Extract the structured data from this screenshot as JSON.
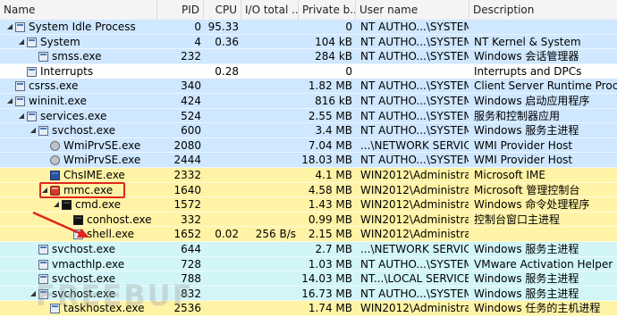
{
  "columns": {
    "name": "Name",
    "pid": "PID",
    "cpu": "CPU",
    "io": "I/O total ...",
    "private": "Private b...",
    "user": "User name",
    "description": "Description"
  },
  "colors": {
    "service": "#cfe7ff",
    "own": "#fff3a6",
    "system": "#ffffff",
    "network": "#d2f5f8",
    "highlight_box": "#e0261f",
    "arrow": "#e0261f"
  },
  "processes": [
    {
      "name": "System Idle Process",
      "pid": "0",
      "cpu": "95.33",
      "io": "",
      "private": "0",
      "user": "NT AUTHO...\\SYSTEM",
      "description": "",
      "indent": 0,
      "twisty": "open",
      "icon": "window-icon",
      "kind": "service"
    },
    {
      "name": "System",
      "pid": "4",
      "cpu": "0.36",
      "io": "",
      "private": "104 kB",
      "user": "NT AUTHO...\\SYSTEM",
      "description": "NT Kernel & System",
      "indent": 1,
      "twisty": "open",
      "icon": "window-icon",
      "kind": "service"
    },
    {
      "name": "smss.exe",
      "pid": "232",
      "cpu": "",
      "io": "",
      "private": "284 kB",
      "user": "NT AUTHO...\\SYSTEM",
      "description": "Windows 会话管理器",
      "indent": 2,
      "twisty": "",
      "icon": "window-icon",
      "kind": "service"
    },
    {
      "name": "Interrupts",
      "pid": "",
      "cpu": "0.28",
      "io": "",
      "private": "0",
      "user": "",
      "description": "Interrupts and DPCs",
      "indent": 1,
      "twisty": "",
      "icon": "window-icon",
      "kind": "system"
    },
    {
      "name": "csrss.exe",
      "pid": "340",
      "cpu": "",
      "io": "",
      "private": "1.82 MB",
      "user": "NT AUTHO...\\SYSTEM",
      "description": "Client Server Runtime Proc...",
      "indent": 0,
      "twisty": "",
      "icon": "window-icon",
      "kind": "service"
    },
    {
      "name": "wininit.exe",
      "pid": "424",
      "cpu": "",
      "io": "",
      "private": "816 kB",
      "user": "NT AUTHO...\\SYSTEM",
      "description": "Windows 启动应用程序",
      "indent": 0,
      "twisty": "open",
      "icon": "window-icon",
      "kind": "service"
    },
    {
      "name": "services.exe",
      "pid": "524",
      "cpu": "",
      "io": "",
      "private": "2.55 MB",
      "user": "NT AUTHO...\\SYSTEM",
      "description": "服务和控制器应用",
      "indent": 1,
      "twisty": "open",
      "icon": "window-icon",
      "kind": "service"
    },
    {
      "name": "svchost.exe",
      "pid": "600",
      "cpu": "",
      "io": "",
      "private": "3.4 MB",
      "user": "NT AUTHO...\\SYSTEM",
      "description": "Windows 服务主进程",
      "indent": 2,
      "twisty": "open",
      "icon": "window-icon",
      "kind": "service"
    },
    {
      "name": "WmiPrvSE.exe",
      "pid": "2080",
      "cpu": "",
      "io": "",
      "private": "7.04 MB",
      "user": "...\\NETWORK SERVICE",
      "description": "WMI Provider Host",
      "indent": 3,
      "twisty": "",
      "icon": "gear-icon",
      "kind": "service"
    },
    {
      "name": "WmiPrvSE.exe",
      "pid": "2444",
      "cpu": "",
      "io": "",
      "private": "18.03 MB",
      "user": "NT AUTHO...\\SYSTEM",
      "description": "WMI Provider Host",
      "indent": 3,
      "twisty": "",
      "icon": "gear-icon",
      "kind": "service"
    },
    {
      "name": "ChsIME.exe",
      "pid": "2332",
      "cpu": "",
      "io": "",
      "private": "4.1 MB",
      "user": "WIN2012\\Administrat",
      "description": "Microsoft IME",
      "indent": 3,
      "twisty": "",
      "icon": "ime-icon",
      "kind": "own"
    },
    {
      "name": "mmc.exe",
      "pid": "1640",
      "cpu": "",
      "io": "",
      "private": "4.58 MB",
      "user": "WIN2012\\Administrat",
      "description": "Microsoft 管理控制台",
      "indent": 3,
      "twisty": "open",
      "icon": "mmc-icon",
      "kind": "own"
    },
    {
      "name": "cmd.exe",
      "pid": "1572",
      "cpu": "",
      "io": "",
      "private": "1.43 MB",
      "user": "WIN2012\\Administrat",
      "description": "Windows 命令处理程序",
      "indent": 4,
      "twisty": "open",
      "icon": "cmd-icon",
      "kind": "own"
    },
    {
      "name": "conhost.exe",
      "pid": "332",
      "cpu": "",
      "io": "",
      "private": "0.99 MB",
      "user": "WIN2012\\Administrat",
      "description": "控制台窗口主进程",
      "indent": 5,
      "twisty": "",
      "icon": "cmd-icon",
      "kind": "own"
    },
    {
      "name": "shell.exe",
      "pid": "1652",
      "cpu": "0.02",
      "io": "256 B/s",
      "private": "2.15 MB",
      "user": "WIN2012\\Administrat",
      "description": "",
      "indent": 5,
      "twisty": "",
      "icon": "window-icon",
      "kind": "own"
    },
    {
      "name": "svchost.exe",
      "pid": "644",
      "cpu": "",
      "io": "",
      "private": "2.7 MB",
      "user": "...\\NETWORK SERVICE",
      "description": "Windows 服务主进程",
      "indent": 2,
      "twisty": "",
      "icon": "window-icon",
      "kind": "network"
    },
    {
      "name": "vmacthlp.exe",
      "pid": "728",
      "cpu": "",
      "io": "",
      "private": "1.03 MB",
      "user": "NT AUTHO...\\SYSTEM",
      "description": "VMware Activation Helper",
      "indent": 2,
      "twisty": "",
      "icon": "window-icon",
      "kind": "network"
    },
    {
      "name": "svchost.exe",
      "pid": "788",
      "cpu": "",
      "io": "",
      "private": "14.03 MB",
      "user": "NT...\\LOCAL SERVICE",
      "description": "Windows 服务主进程",
      "indent": 2,
      "twisty": "",
      "icon": "window-icon",
      "kind": "network"
    },
    {
      "name": "svchost.exe",
      "pid": "832",
      "cpu": "",
      "io": "",
      "private": "16.73 MB",
      "user": "NT AUTHO...\\SYSTEM",
      "description": "Windows 服务主进程",
      "indent": 2,
      "twisty": "open",
      "icon": "window-icon",
      "kind": "network"
    },
    {
      "name": "taskhostex.exe",
      "pid": "2536",
      "cpu": "",
      "io": "",
      "private": "1.74 MB",
      "user": "WIN2012\\Administrat",
      "description": "Windows 任务的主机进程",
      "indent": 3,
      "twisty": "",
      "icon": "window-icon",
      "kind": "own"
    }
  ],
  "watermark": "FREEBUF"
}
